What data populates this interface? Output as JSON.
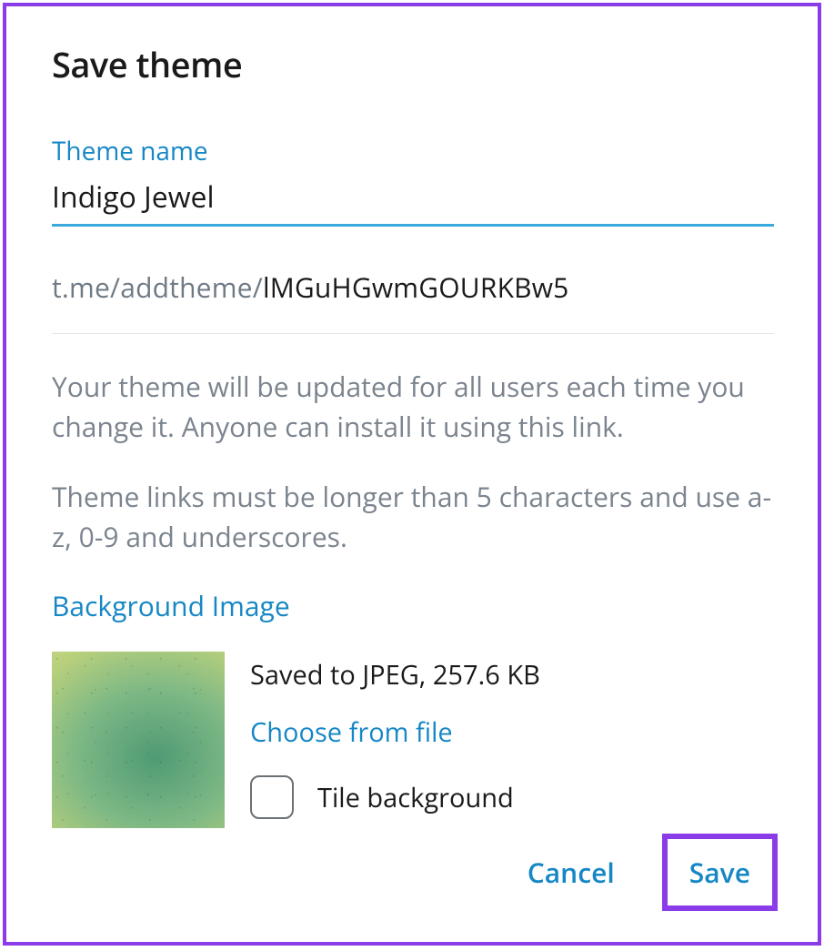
{
  "dialog": {
    "title": "Save theme",
    "themeNameLabel": "Theme name",
    "themeNameValue": "Indigo Jewel",
    "linkPrefix": "t.me/addtheme/",
    "linkSlug": "lMGuHGwmGOURKBw5",
    "description1": "Your theme will be updated for all users each time you change it. Anyone can install it using this link.",
    "description2": "Theme links must be longer than 5 characters and use a-z, 0-9 and underscores.",
    "bgSectionLabel": "Background Image",
    "bgStatus": "Saved to JPEG, 257.6 KB",
    "chooseFile": "Choose from file",
    "tileLabel": "Tile background",
    "cancelLabel": "Cancel",
    "saveLabel": "Save"
  }
}
